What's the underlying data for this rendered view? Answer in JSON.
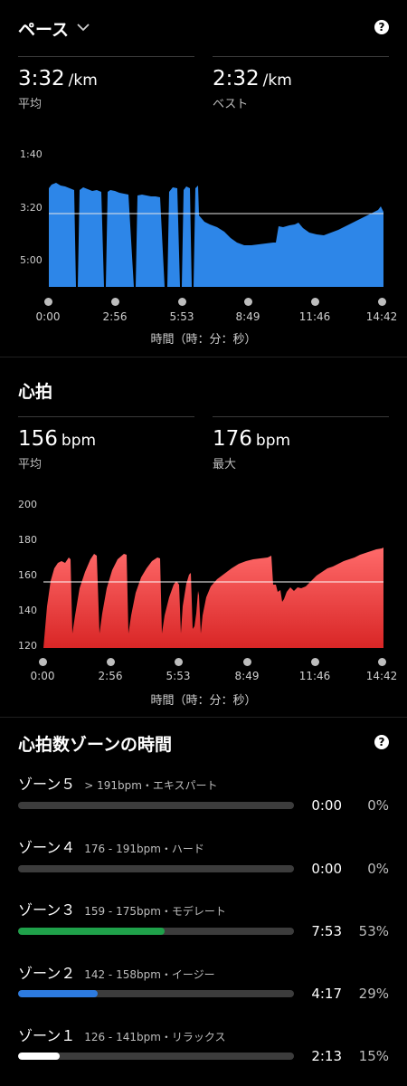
{
  "pace": {
    "title": "ペース",
    "avg_value": "3:32",
    "avg_unit": "/km",
    "avg_label": "平均",
    "best_value": "2:32",
    "best_unit": "/km",
    "best_label": "ベスト",
    "help": "?",
    "y_ticks": [
      "1:40",
      "3:20",
      "5:00"
    ],
    "x_ticks": [
      "0:00",
      "2:56",
      "5:53",
      "8:49",
      "11:46",
      "14:42"
    ],
    "x_title": "時間（時：分：秒）",
    "fill_color": "#2d86e8"
  },
  "heart": {
    "title": "心拍",
    "avg_value": "156",
    "avg_unit": "bpm",
    "avg_label": "平均",
    "max_value": "176",
    "max_unit": "bpm",
    "max_label": "最大",
    "y_ticks": [
      "200",
      "180",
      "160",
      "140",
      "120"
    ],
    "x_ticks": [
      "0:00",
      "2:56",
      "5:53",
      "8:49",
      "11:46",
      "14:42"
    ],
    "x_title": "時間（時：分：秒）",
    "fill_color": "#f25050"
  },
  "zones": {
    "title": "心拍数ゾーンの時間",
    "help": "?",
    "items": [
      {
        "name": "ゾーン５",
        "range": "> 191bpm・エキスパート",
        "time": "0:00",
        "percent": "0%",
        "fraction": 0,
        "color": "#888888"
      },
      {
        "name": "ゾーン４",
        "range": "176 - 191bpm・ハード",
        "time": "0:00",
        "percent": "0%",
        "fraction": 0,
        "color": "#888888"
      },
      {
        "name": "ゾーン３",
        "range": "159 - 175bpm・モデレート",
        "time": "7:53",
        "percent": "53%",
        "fraction": 0.53,
        "color": "#1fa14a"
      },
      {
        "name": "ゾーン２",
        "range": "142 - 158bpm・イージー",
        "time": "4:17",
        "percent": "29%",
        "fraction": 0.29,
        "color": "#2d7be0"
      },
      {
        "name": "ゾーン１",
        "range": "126 - 141bpm・リラックス",
        "time": "2:13",
        "percent": "15%",
        "fraction": 0.15,
        "color": "#ffffff"
      }
    ]
  }
}
